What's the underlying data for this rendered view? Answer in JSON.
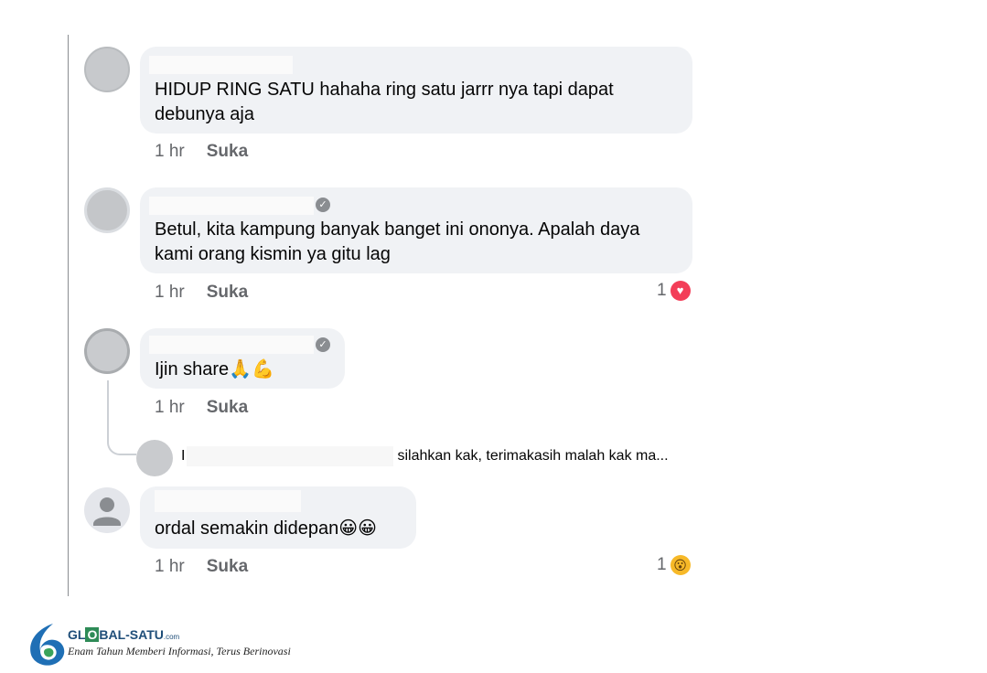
{
  "comments": [
    {
      "text": "HIDUP RING SATU hahaha ring satu jarrr nya tapi dapat\ndebunya aja",
      "time": "1 hr",
      "like": "Suka"
    },
    {
      "text": "Betul, kita kampung banyak banget ini ononya. Apalah daya\nkami orang kismin ya gitu lag",
      "time": "1 hr",
      "like": "Suka",
      "reaction_count": "1",
      "reaction_icon": "love-reaction"
    },
    {
      "text": "Ijin share🙏💪",
      "time": "1 hr",
      "like": "Suka",
      "reply": {
        "initial": "I",
        "text": "silahkan kak, terimakasih malah kak ma..."
      }
    },
    {
      "text": "ordal semakin didepan😀😀",
      "time": "1 hr",
      "like": "Suka",
      "reaction_count": "1",
      "reaction_icon": "wow-reaction"
    }
  ],
  "watermark": {
    "brand_prefix": "GL",
    "brand_logo_letter": "O",
    "brand_mid": "BAL",
    "brand_suffix": "-SATU",
    "brand_domain": ".com",
    "tagline": "Enam Tahun Memberi Informasi, Terus Berinovasi"
  },
  "colors": {
    "bubble": "#f0f2f5",
    "meta_text": "#65676b",
    "love": "#f33e58",
    "wow": "#f7b928",
    "brand": "#1f4e79"
  }
}
